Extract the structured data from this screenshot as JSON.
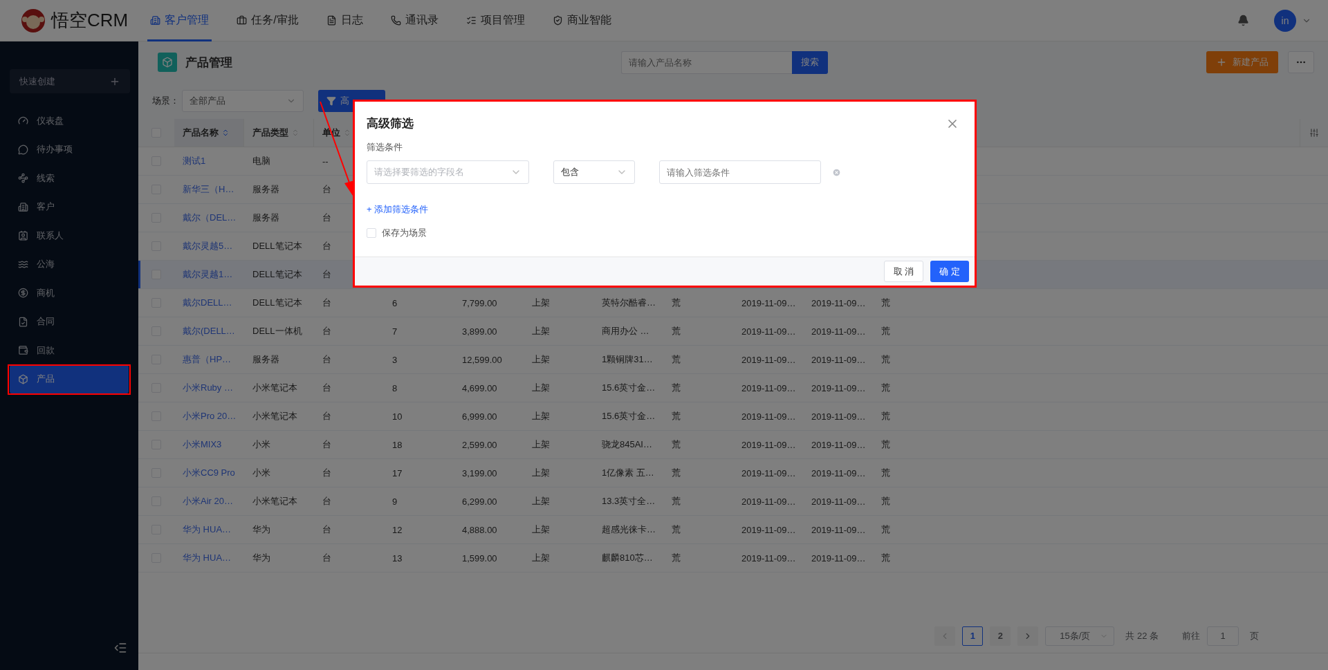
{
  "top_nav": {
    "logo": "悟空CRM",
    "tabs": [
      {
        "label": "客户管理",
        "selected": true
      },
      {
        "label": "任务/审批",
        "selected": false
      },
      {
        "label": "日志",
        "selected": false
      },
      {
        "label": "通讯录",
        "selected": false
      },
      {
        "label": "项目管理",
        "selected": false
      },
      {
        "label": "商业智能",
        "selected": false
      }
    ],
    "avatar": "in"
  },
  "sidebar": {
    "quick_create": "快速创建",
    "items": [
      {
        "label": "仪表盘",
        "selected": false
      },
      {
        "label": "待办事项",
        "selected": false
      },
      {
        "label": "线索",
        "selected": false
      },
      {
        "label": "客户",
        "selected": false
      },
      {
        "label": "联系人",
        "selected": false
      },
      {
        "label": "公海",
        "selected": false
      },
      {
        "label": "商机",
        "selected": false
      },
      {
        "label": "合同",
        "selected": false
      },
      {
        "label": "回款",
        "selected": false
      },
      {
        "label": "产品",
        "selected": true
      }
    ]
  },
  "page": {
    "title": "产品管理",
    "search": {
      "placeholder": "请输入产品名称",
      "button": "搜索"
    },
    "new_button": "新建产品"
  },
  "scene": {
    "label": "场景：",
    "value": "全部产品",
    "filter_button": "高"
  },
  "table": {
    "all_checked": false,
    "columns": [
      {
        "label": "产品名称",
        "sorted": true
      },
      {
        "label": "产品类型",
        "sorted": false
      },
      {
        "label": "单位",
        "sorted": false
      }
    ],
    "rows": [
      {
        "checked": false,
        "highlighted": false,
        "cells": [
          "测试1",
          "电脑",
          "--"
        ]
      },
      {
        "checked": false,
        "highlighted": false,
        "cells": [
          "新华三（H…",
          "服务器",
          "台"
        ]
      },
      {
        "checked": false,
        "highlighted": false,
        "cells": [
          "戴尔（DEL…",
          "服务器",
          "台"
        ]
      },
      {
        "checked": false,
        "highlighted": false,
        "cells": [
          "戴尔灵越5…",
          "DELL笔记本",
          "台"
        ]
      },
      {
        "checked": false,
        "highlighted": true,
        "cells": [
          "戴尔灵越1…",
          "DELL笔记本",
          "台"
        ]
      },
      {
        "checked": false,
        "highlighted": false,
        "cells": [
          "戴尔DELL…",
          "DELL笔记本",
          "台",
          "6",
          "7,799.00",
          "上架",
          "英特尔酷睿…",
          "荒",
          "2019-11-09…",
          "2019-11-09…",
          "荒"
        ]
      },
      {
        "checked": false,
        "highlighted": false,
        "cells": [
          "戴尔(DELL…",
          "DELL一体机",
          "台",
          "7",
          "3,899.00",
          "上架",
          "商用办公 …",
          "荒",
          "2019-11-09…",
          "2019-11-09…",
          "荒"
        ]
      },
      {
        "checked": false,
        "highlighted": false,
        "cells": [
          "惠普（HP…",
          "服务器",
          "台",
          "3",
          "12,599.00",
          "上架",
          "1颗铜牌31…",
          "荒",
          "2019-11-09…",
          "2019-11-09…",
          "荒"
        ]
      },
      {
        "checked": false,
        "highlighted": false,
        "cells": [
          "小米Ruby …",
          "小米笔记本",
          "台",
          "8",
          "4,699.00",
          "上架",
          "15.6英寸金…",
          "荒",
          "2019-11-09…",
          "2019-11-09…",
          "荒"
        ]
      },
      {
        "checked": false,
        "highlighted": false,
        "cells": [
          "小米Pro 20…",
          "小米笔记本",
          "台",
          "10",
          "6,999.00",
          "上架",
          "15.6英寸金…",
          "荒",
          "2019-11-09…",
          "2019-11-09…",
          "荒"
        ]
      },
      {
        "checked": false,
        "highlighted": false,
        "cells": [
          "小米MIX3",
          "小米",
          "台",
          "18",
          "2,599.00",
          "上架",
          "骁龙845AI…",
          "荒",
          "2019-11-09…",
          "2019-11-09…",
          "荒"
        ]
      },
      {
        "checked": false,
        "highlighted": false,
        "cells": [
          "小米CC9 Pro",
          "小米",
          "台",
          "17",
          "3,199.00",
          "上架",
          "1亿像素 五…",
          "荒",
          "2019-11-09…",
          "2019-11-09…",
          "荒"
        ]
      },
      {
        "checked": false,
        "highlighted": false,
        "cells": [
          "小米Air 20…",
          "小米笔记本",
          "台",
          "9",
          "6,299.00",
          "上架",
          "13.3英寸全…",
          "荒",
          "2019-11-09…",
          "2019-11-09…",
          "荒"
        ]
      },
      {
        "checked": false,
        "highlighted": false,
        "cells": [
          "华为 HUA…",
          "华为",
          "台",
          "12",
          "4,888.00",
          "上架",
          "超感光徕卡…",
          "荒",
          "2019-11-09…",
          "2019-11-09…",
          "荒"
        ]
      },
      {
        "checked": false,
        "highlighted": false,
        "cells": [
          "华为 HUA…",
          "华为",
          "台",
          "13",
          "1,599.00",
          "上架",
          "麒麟810芯…",
          "荒",
          "2019-11-09…",
          "2019-11-09…",
          "荒"
        ]
      }
    ]
  },
  "pagination": {
    "pages": [
      {
        "label": "1",
        "selected": true
      },
      {
        "label": "2",
        "selected": false
      }
    ],
    "page_size": "15条/页",
    "total": "共 22 条",
    "goto_label": "前往",
    "goto_value": "1",
    "goto_suffix": "页"
  },
  "dialog": {
    "title": "高级筛选",
    "section_label": "筛选条件",
    "conditions": [
      {
        "field_placeholder": "请选择要筛选的字段名",
        "operator": "包含",
        "value_placeholder": "请输入筛选条件"
      }
    ],
    "add_link": "+ 添加筛选条件",
    "save_scene": {
      "label": "保存为场景",
      "checked": false
    },
    "cancel": "取 消",
    "confirm": "确 定"
  }
}
